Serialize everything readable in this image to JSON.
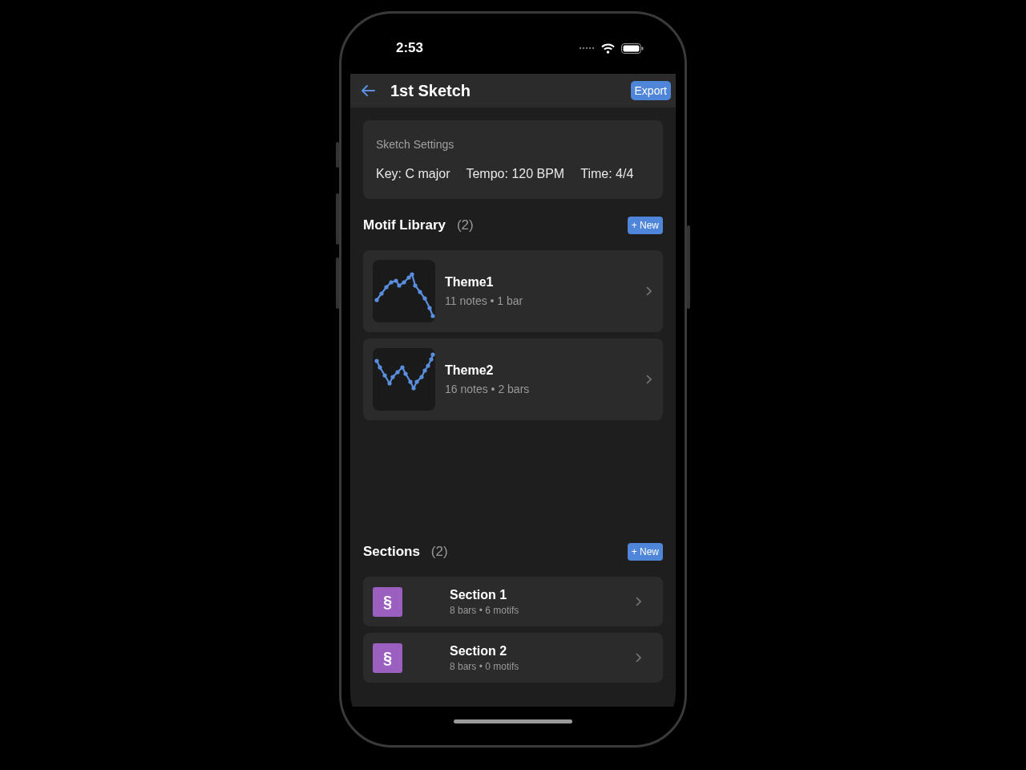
{
  "status_bar": {
    "time": "2:53"
  },
  "nav": {
    "title": "1st Sketch",
    "action": "Export"
  },
  "settings": {
    "title": "Sketch Settings",
    "items": [
      "Key: C major",
      "Tempo: 120 BPM",
      "Time: 4/4"
    ]
  },
  "motif_library": {
    "title": "Motif Library",
    "count": "(2)",
    "new_button": "+ New",
    "motifs": [
      {
        "name": "Theme1",
        "details": "11 notes • 1 bar"
      },
      {
        "name": "Theme2",
        "details": "16 notes • 2 bars"
      }
    ]
  },
  "sections": {
    "title": "Sections",
    "count": "(2)",
    "new_button": "+ New",
    "items": [
      {
        "icon": "§",
        "name": "Section 1",
        "details": "8 bars • 6 motifs"
      },
      {
        "icon": "§",
        "name": "Section 2",
        "details": "8 bars • 0 motifs"
      }
    ]
  }
}
